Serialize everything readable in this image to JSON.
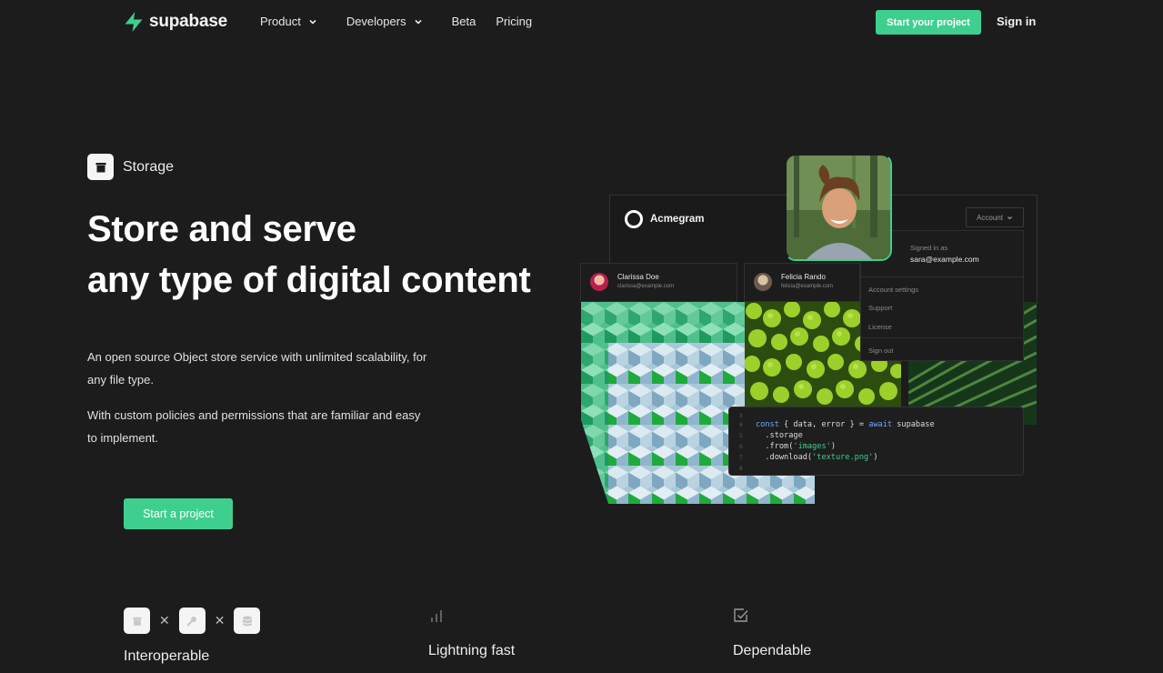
{
  "nav": {
    "brand": "supabase",
    "links": [
      {
        "label": "Product",
        "has_dropdown": true
      },
      {
        "label": "Developers",
        "has_dropdown": true
      },
      {
        "label": "Beta",
        "has_dropdown": false
      },
      {
        "label": "Pricing",
        "has_dropdown": false
      }
    ],
    "cta_label": "Start your project",
    "signin_label": "Sign in"
  },
  "hero": {
    "product_label": "Storage",
    "product_icon": "storage-box-icon",
    "title_line1": "Store and serve",
    "title_line2": "any type of digital content",
    "desc1": "An open source Object store service with unlimited scalability, for any file type.",
    "desc2": "With custom policies and permissions that are familiar and easy to implement.",
    "cta_label": "Start a project"
  },
  "illustration": {
    "app_name": "Acmegram",
    "account_label": "Account",
    "signed_in_as": "Signed in as",
    "signed_in_email": "sara@example.com",
    "menu_items": [
      "Account settings",
      "Support",
      "License",
      "Sign out"
    ],
    "users": [
      {
        "name": "Clarissa Doe",
        "email": "clarissa@example.com"
      },
      {
        "name": "Felicia Rando",
        "email": "felicia@example.com"
      }
    ],
    "code": {
      "line_numbers": [
        "3",
        "4",
        "5",
        "6",
        "7",
        "8"
      ],
      "l4_kw": "const",
      "l4_mid": " { data, error } = ",
      "l4_kw2": "await",
      "l4_end": " supabase",
      "l5": "  .storage",
      "l6_a": "  .from(",
      "l6_str": "'images'",
      "l6_b": ")",
      "l7_a": "  .download(",
      "l7_str": "'texture.png'",
      "l7_b": ")"
    }
  },
  "features": [
    {
      "title": "Interoperable",
      "icons": [
        "storage-box-icon",
        "key-icon",
        "database-icon"
      ]
    },
    {
      "title": "Lightning fast",
      "icon": "bar-chart-icon"
    },
    {
      "title": "Dependable",
      "icon": "checkbox-icon"
    }
  ],
  "colors": {
    "accent": "#3ecf8e",
    "background": "#1c1c1c"
  }
}
